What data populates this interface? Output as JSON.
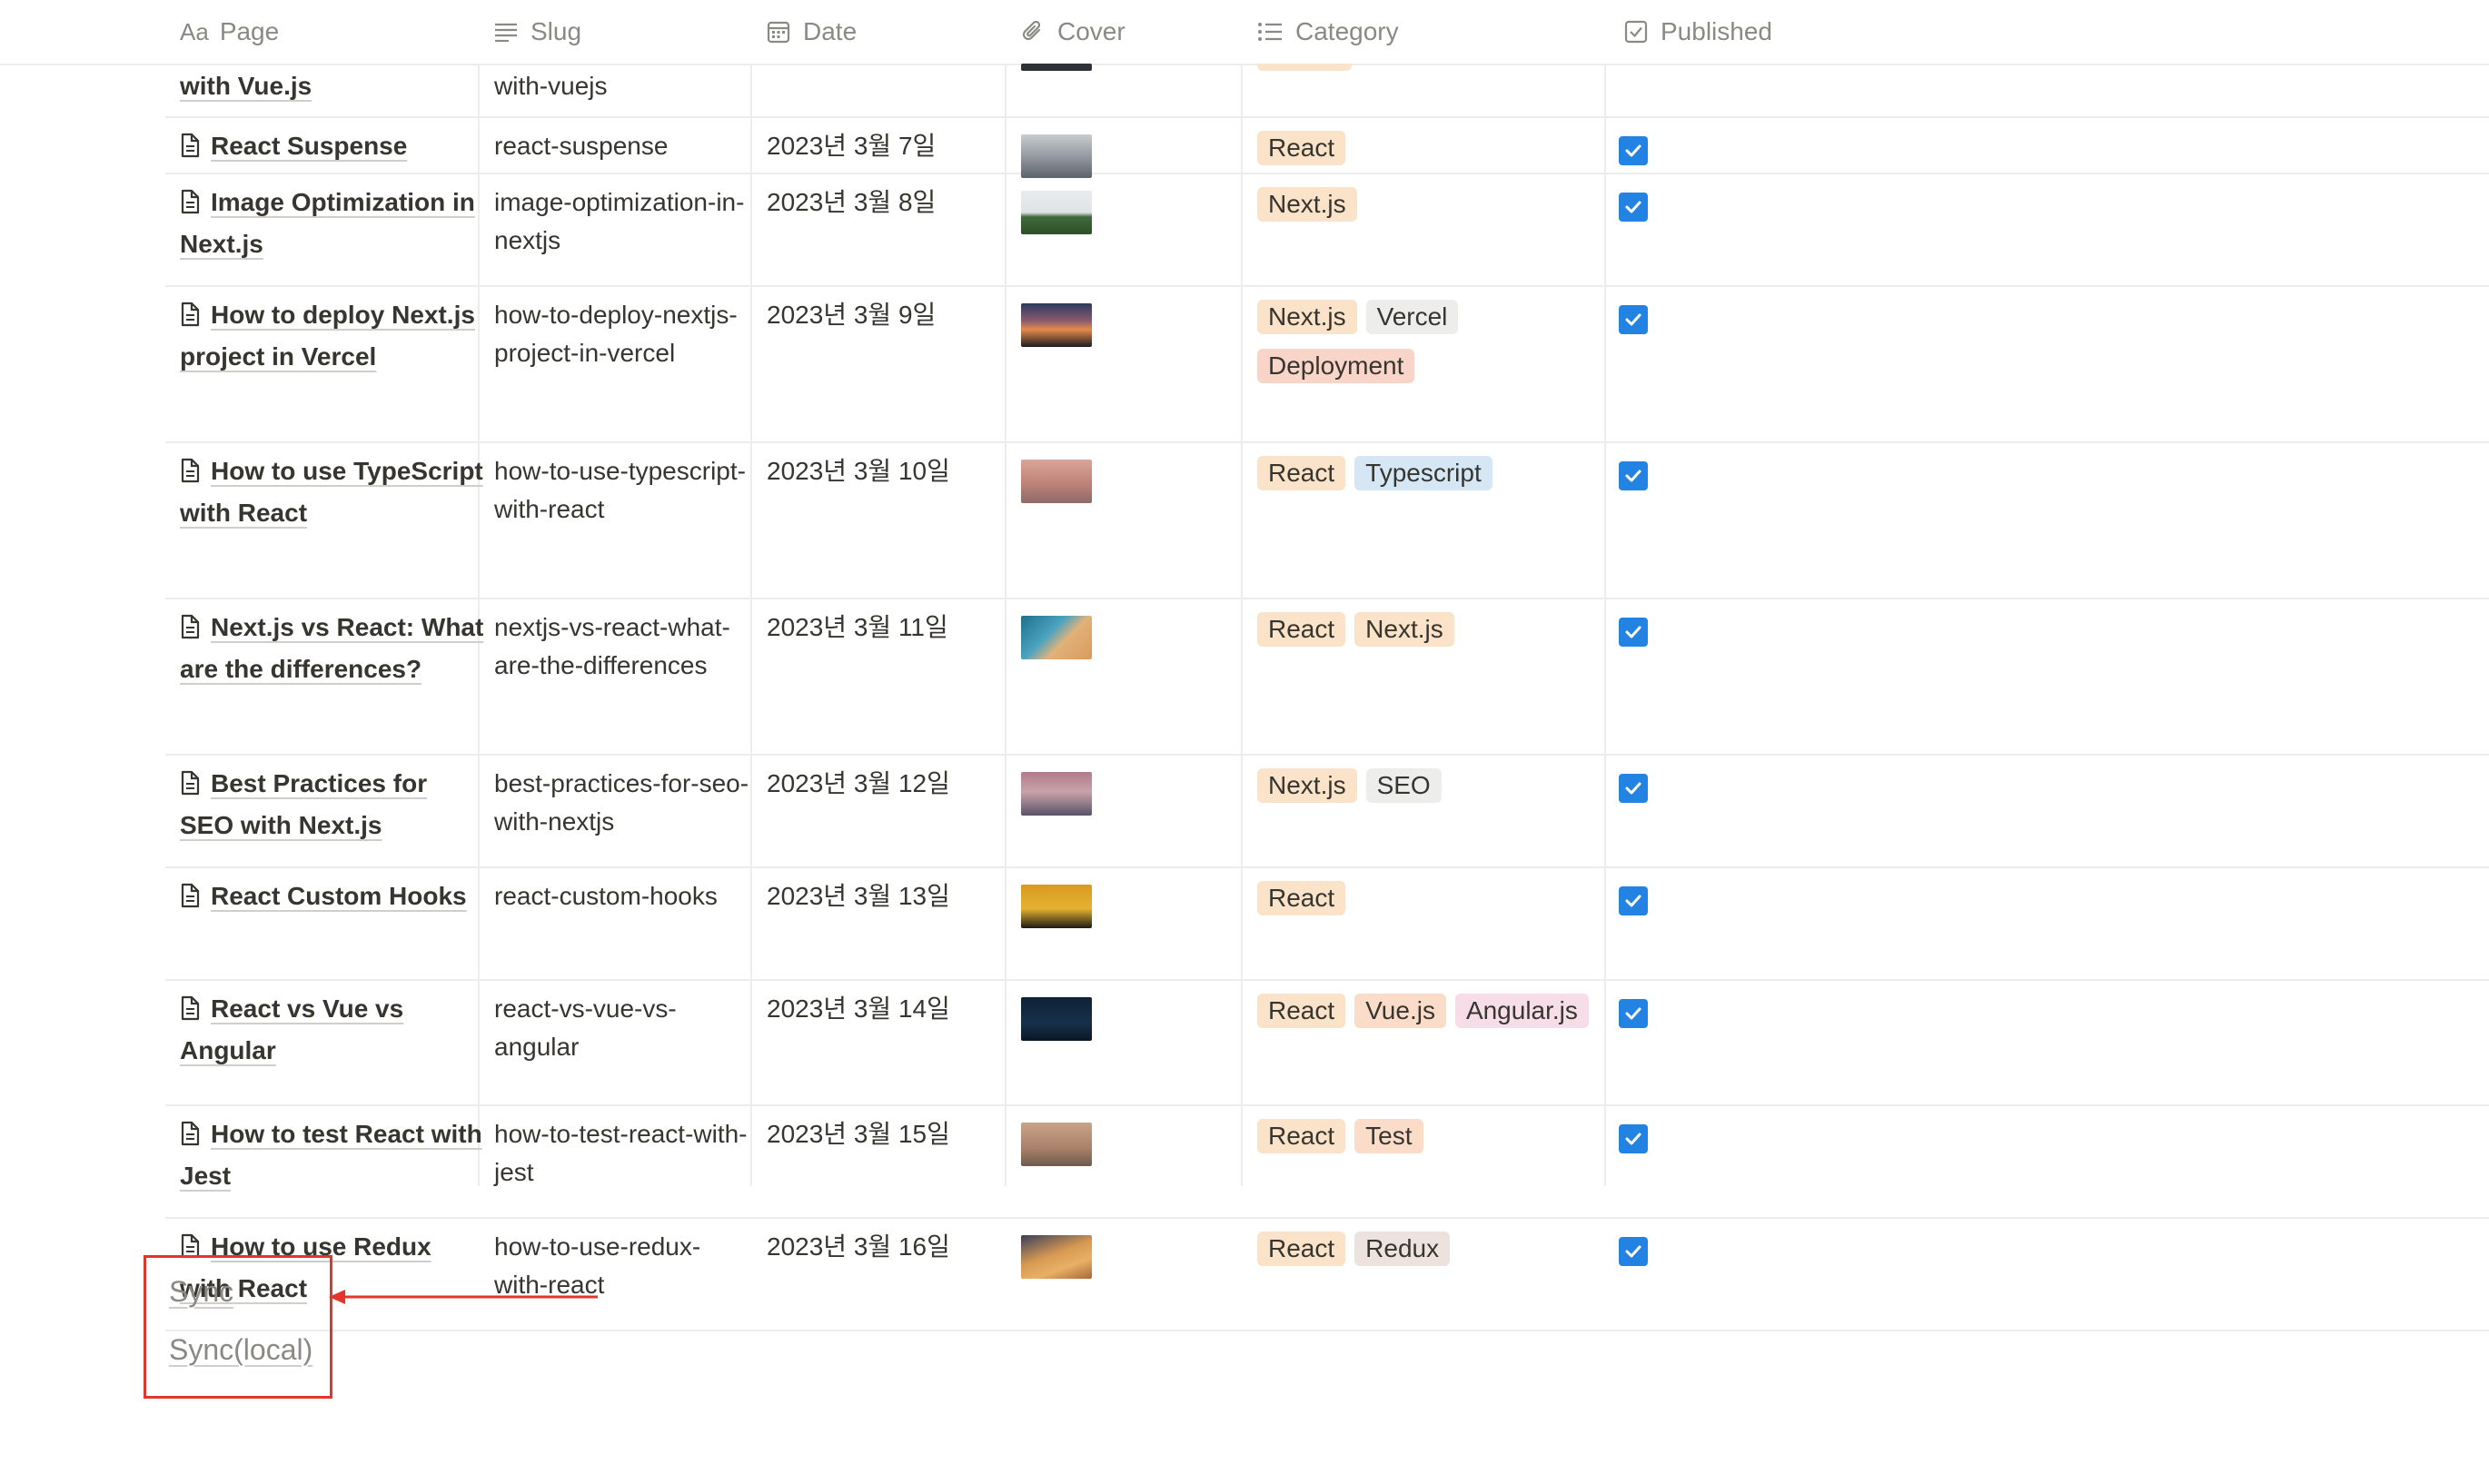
{
  "columns": {
    "page": "Page",
    "page_icon": "Aa",
    "slug": "Slug",
    "date": "Date",
    "cover": "Cover",
    "category": "Category",
    "published": "Published"
  },
  "partial_row": {
    "title": "with Vue.js",
    "slug": "with-vuejs"
  },
  "rows": [
    {
      "title": "React Suspense",
      "slug": "react-suspense",
      "date": "2023년 3월 7일",
      "cover": "mountain-rocks",
      "tags": [
        "React"
      ],
      "published": true
    },
    {
      "title": "Image Optimization in Next.js",
      "slug": "image-optimization-in-nextjs",
      "date": "2023년 3월 8일",
      "cover": "green-hill",
      "tags": [
        "Next.js"
      ],
      "published": true
    },
    {
      "title": "How to deploy Next.js project in Vercel",
      "slug": "how-to-deploy-nextjs-project-in-vercel",
      "date": "2023년 3월 9일",
      "cover": "sunset-mountains",
      "tags": [
        "Next.js",
        "Vercel",
        "Deployment"
      ],
      "published": true
    },
    {
      "title": "How to use TypeScript with React",
      "slug": "how-to-use-typescript-with-react",
      "date": "2023년 3월 10일",
      "cover": "pink-clouds",
      "tags": [
        "React",
        "Typescript"
      ],
      "published": true
    },
    {
      "title": "Next.js vs React: What are the differences?",
      "slug": "nextjs-vs-react-what-are-the-differences",
      "date": "2023년 3월 11일",
      "cover": "coast-aerial",
      "tags": [
        "React",
        "Next.js"
      ],
      "published": true
    },
    {
      "title": "Best Practices for SEO with Next.js",
      "slug": "best-practices-for-seo-with-nextjs",
      "date": "2023년 3월 12일",
      "cover": "snowy-peaks",
      "tags": [
        "Next.js",
        "SEO"
      ],
      "published": true
    },
    {
      "title": "React Custom Hooks",
      "slug": "react-custom-hooks",
      "date": "2023년 3월 13일",
      "cover": "golden-palm",
      "tags": [
        "React"
      ],
      "published": true
    },
    {
      "title": "React vs Vue vs Angular",
      "slug": "react-vs-vue-vs-angular",
      "date": "2023년 3월 14일",
      "cover": "night-sky",
      "tags": [
        "React",
        "Vue.js",
        "Angular.js"
      ],
      "published": true
    },
    {
      "title": "How to test React with Jest",
      "slug": "how-to-test-react-with-jest",
      "date": "2023년 3월 15일",
      "cover": "hazy-city",
      "tags": [
        "React",
        "Test"
      ],
      "published": true
    },
    {
      "title": "How to use Redux with React",
      "slug": "how-to-use-redux-with-react",
      "date": "2023년 3월 16일",
      "cover": "desert-dunes",
      "tags": [
        "React",
        "Redux"
      ],
      "published": true
    }
  ],
  "links": {
    "sync": "Sync",
    "sync_local": "Sync(local)"
  },
  "colors": {
    "accent": "#2383e2",
    "highlight_border": "#e5352b"
  }
}
